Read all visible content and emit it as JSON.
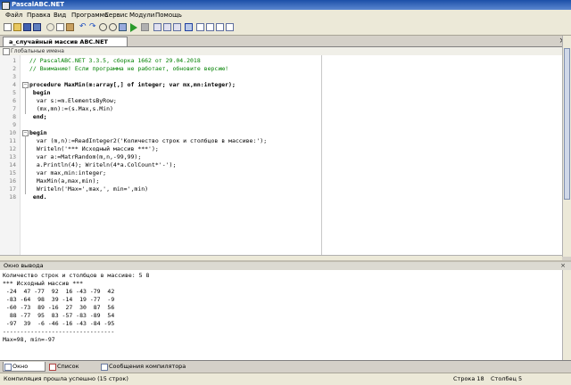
{
  "window": {
    "title": "PascalABC.NET"
  },
  "menu": [
    "Файл",
    "Правка",
    "Вид",
    "Программа",
    "Сервис",
    "Модули",
    "Помощь"
  ],
  "toolbar": {
    "icons": [
      "new-file-icon",
      "open-icon",
      "save-icon",
      "save-all-icon",
      "cut-icon",
      "copy-icon",
      "paste-icon",
      "undo-icon",
      "redo-icon",
      "find-icon",
      "find-next-icon",
      "replace-icon",
      "run-icon",
      "stop-icon",
      "step-icon",
      "step-over-icon",
      "step-out-icon",
      "debug-icon",
      "layout-icon",
      "window-icon",
      "settings-icon",
      "split-icon"
    ]
  },
  "editor_tab": {
    "label": "a_случайный массив ABC.NET 3.3.pas*",
    "close": "×"
  },
  "panel_header": "Глобальные имена",
  "code_lines": [
    {
      "n": "1",
      "t": "// PascalABC.NET 3.3.5, сборка 1662 от 29.04.2018",
      "c": "cm"
    },
    {
      "n": "2",
      "t": "// Внимание! Если программа не работает, обновите версию!",
      "c": "cm"
    },
    {
      "n": "3",
      "t": "",
      "c": ""
    },
    {
      "n": "4",
      "t": "procedure MaxMin(m:array[,] of integer; var mx,mn:integer);",
      "c": "kw"
    },
    {
      "n": "5",
      "t": " begin",
      "c": "kw"
    },
    {
      "n": "6",
      "t": "  var s:=m.ElementsByRow;",
      "c": ""
    },
    {
      "n": "7",
      "t": "  (mx,mn):=(s.Max,s.Min)",
      "c": ""
    },
    {
      "n": "8",
      "t": " end;",
      "c": "kw"
    },
    {
      "n": "9",
      "t": "",
      "c": ""
    },
    {
      "n": "10",
      "t": "begin",
      "c": "kw"
    },
    {
      "n": "11",
      "t": "  var (m,n):=ReadInteger2('Количество строк и столбцов в массиве:');",
      "c": ""
    },
    {
      "n": "12",
      "t": "  Writeln('*** Исходный массив ***');",
      "c": ""
    },
    {
      "n": "13",
      "t": "  var a:=MatrRandom(m,n,-99,99);",
      "c": ""
    },
    {
      "n": "14",
      "t": "  a.Println(4); Writeln(4*a.ColCount*'-');",
      "c": ""
    },
    {
      "n": "15",
      "t": "  var max,min:integer;",
      "c": ""
    },
    {
      "n": "16",
      "t": "  MaxMin(a,max,min);",
      "c": ""
    },
    {
      "n": "17",
      "t": "  Writeln('Max=',max,', min=',min)",
      "c": ""
    },
    {
      "n": "18",
      "t": " end.",
      "c": "kw"
    }
  ],
  "output": {
    "title": "Окно вывода",
    "close": "×",
    "lines": [
      "Количество строк и столбцов в массиве: 5 8",
      "*** Исходный массив ***",
      " -24  47 -77  92  16 -43 -79  42",
      " -83 -64  98  39 -14  19 -77  -9",
      " -60 -73  89 -16  27  30  87  56",
      "  88 -77  95  83 -57 -83 -89  54",
      " -97  39  -6 -46 -16 -43 -84 -95",
      "--------------------------------",
      "Max=98, min=-97"
    ]
  },
  "bottom_tabs": [
    "Окно вывода",
    "Список ошибок",
    "Сообщения компилятора"
  ],
  "status": {
    "message": "Компиляция прошла успешно (15 строк)",
    "row": "Строка  18",
    "col": "Столбец  5"
  }
}
